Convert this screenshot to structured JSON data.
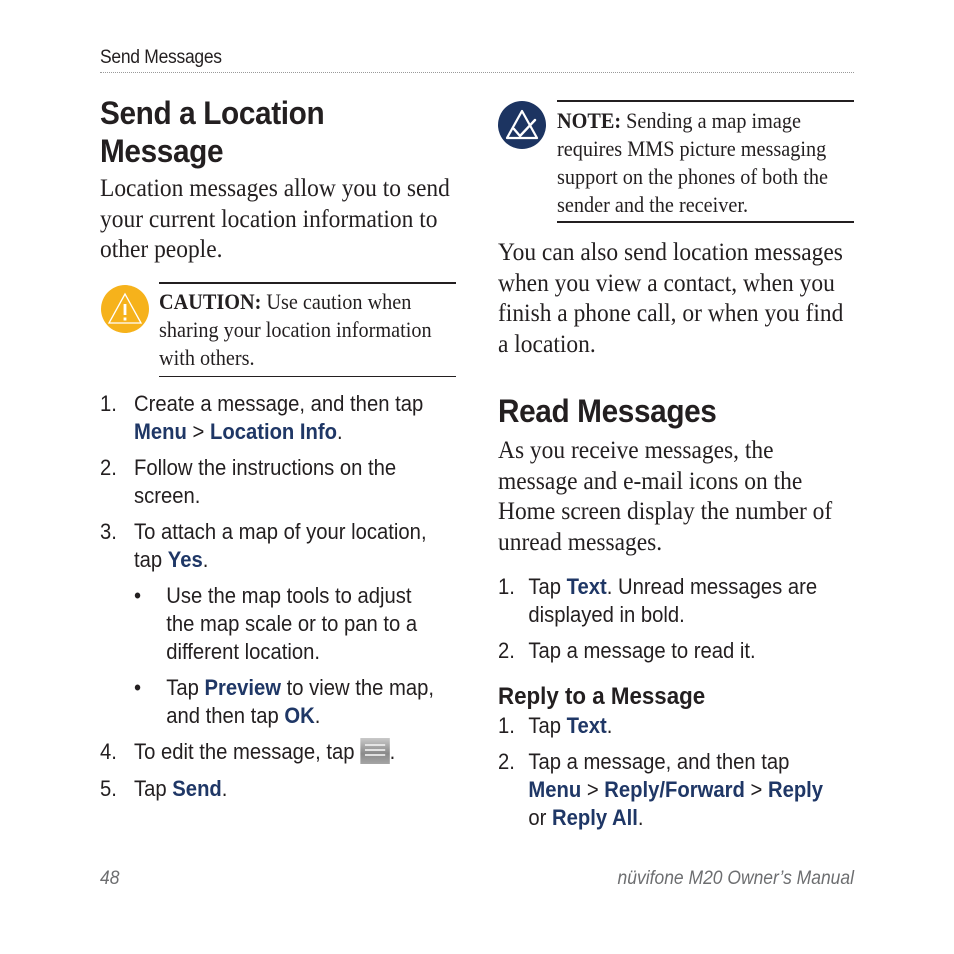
{
  "header": {
    "running_head": "Send Messages"
  },
  "colors": {
    "keyword": "#1f3766",
    "caution_icon": "#f6b21b",
    "note_icon": "#1c3461",
    "footer": "#6d6e70",
    "text": "#231f20"
  },
  "send_location": {
    "title_line1": "Send a Location",
    "title_line2": "Message",
    "intro_lines": [
      "Location messages allow you to send",
      "your current location information to",
      "other people."
    ],
    "caution": {
      "icon": "caution-triangle-icon",
      "label": "CAUTION:",
      "line1_rest": " Use caution when",
      "line2": "sharing your location information",
      "line3": "with others."
    },
    "steps": [
      {
        "num": "1.",
        "line1": "Create a message, and then tap",
        "kw1": "Menu",
        "sep": " > ",
        "kw2": "Location Info",
        "end": "."
      },
      {
        "num": "2.",
        "line1": "Follow the instructions on the",
        "line2": "screen."
      },
      {
        "num": "3.",
        "line1": "To attach a map of your location,",
        "pre": "tap ",
        "kw": "Yes",
        "end": "."
      }
    ],
    "bullets": [
      {
        "symbol": "•",
        "lines": [
          "Use the map tools to adjust",
          "the map scale or to pan to a",
          "different location."
        ]
      },
      {
        "symbol": "•",
        "pre": "Tap ",
        "kw1": "Preview",
        "mid": " to view the map,",
        "line2_pre": "and then tap ",
        "kw2": "OK",
        "end": "."
      }
    ],
    "steps_after": [
      {
        "num": "4.",
        "text": "To edit the message, tap ",
        "icon": "keyboard-icon",
        "end": "."
      },
      {
        "num": "5.",
        "pre": "Tap ",
        "kw": "Send",
        "end": "."
      }
    ]
  },
  "note": {
    "icon": "note-check-icon",
    "label": "NOTE:",
    "line1_rest": " Sending a map image",
    "line2": "requires MMS picture messaging",
    "line3": "support on the phones of both the",
    "line4": "sender and the receiver."
  },
  "also_para": [
    "You can also send location messages",
    "when you view a contact, when you",
    "finish a phone call, or when you find",
    "a location."
  ],
  "read_messages": {
    "title": "Read Messages",
    "intro_lines": [
      "As you receive messages, the",
      "message and e-mail icons on the",
      "Home screen display the number of",
      "unread messages."
    ],
    "steps": [
      {
        "num": "1.",
        "pre": "Tap ",
        "kw": "Text",
        "rest": ". Unread messages are",
        "line2": "displayed in bold."
      },
      {
        "num": "2.",
        "text": "Tap a message to read it."
      }
    ]
  },
  "reply": {
    "title": "Reply to a Message",
    "steps": [
      {
        "num": "1.",
        "pre": "Tap ",
        "kw": "Text",
        "end": "."
      },
      {
        "num": "2.",
        "line1": "Tap a message, and then tap",
        "kw1": "Menu",
        "sep1": " > ",
        "kw2": "Reply/Forward",
        "sep2": " > ",
        "kw3": "Reply",
        "pre3": "or ",
        "kw4": "Reply All",
        "end": "."
      }
    ]
  },
  "footer": {
    "page_number": "48",
    "manual_title": "nüvifone M20 Owner’s Manual"
  }
}
